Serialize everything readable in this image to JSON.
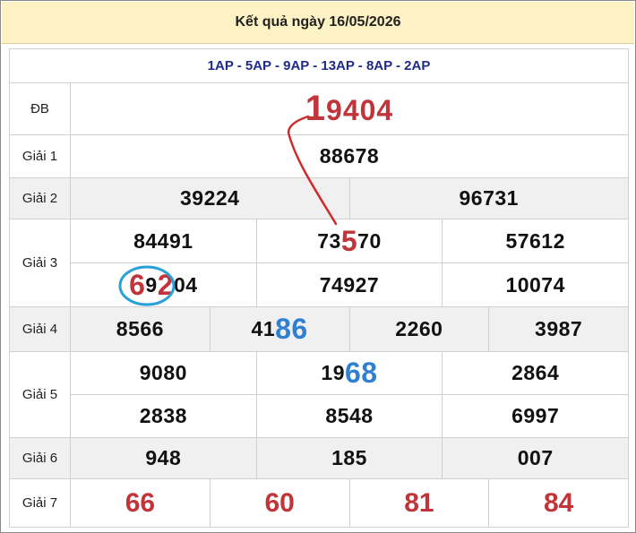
{
  "header": {
    "title": "Kết quả ngày 16/05/2026"
  },
  "stations": "1AP - 5AP - 9AP - 13AP - 8AP - 2AP",
  "rows": {
    "db": {
      "label": "ĐB",
      "first_digit": "1",
      "rest": "9404"
    },
    "g1": {
      "label": "Giải 1",
      "values": [
        "88678"
      ]
    },
    "g2": {
      "label": "Giải 2",
      "values": [
        "39224",
        "96731"
      ]
    },
    "g3": {
      "label": "Giải 3",
      "top": [
        {
          "plain": "84491"
        },
        {
          "pre": "73",
          "hl": "5",
          "post": "70"
        },
        {
          "plain": "57612"
        }
      ],
      "bottom": [
        {
          "a": "6",
          "b": "9",
          "c": "2",
          "post": "04"
        },
        {
          "plain": "74927"
        },
        {
          "plain": "10074"
        }
      ]
    },
    "g4": {
      "label": "Giải 4",
      "values": [
        {
          "plain": "8566"
        },
        {
          "pre": "41",
          "hl": "86"
        },
        {
          "plain": "2260"
        },
        {
          "plain": "3987"
        }
      ]
    },
    "g5": {
      "label": "Giải 5",
      "top": [
        {
          "plain": "9080"
        },
        {
          "pre": "19",
          "hl": "68"
        },
        {
          "plain": "2864"
        }
      ],
      "bottom": [
        "2838",
        "8548",
        "6997"
      ]
    },
    "g6": {
      "label": "Giải 6",
      "values": [
        "948",
        "185",
        "007"
      ]
    },
    "g7": {
      "label": "Giải 7",
      "values": [
        "66",
        "60",
        "81",
        "84"
      ]
    }
  },
  "colors": {
    "header_bg": "#fdf2c4",
    "accent_red": "#c0343a",
    "accent_blue": "#2d80d2",
    "station_blue": "#1f2a8a"
  }
}
